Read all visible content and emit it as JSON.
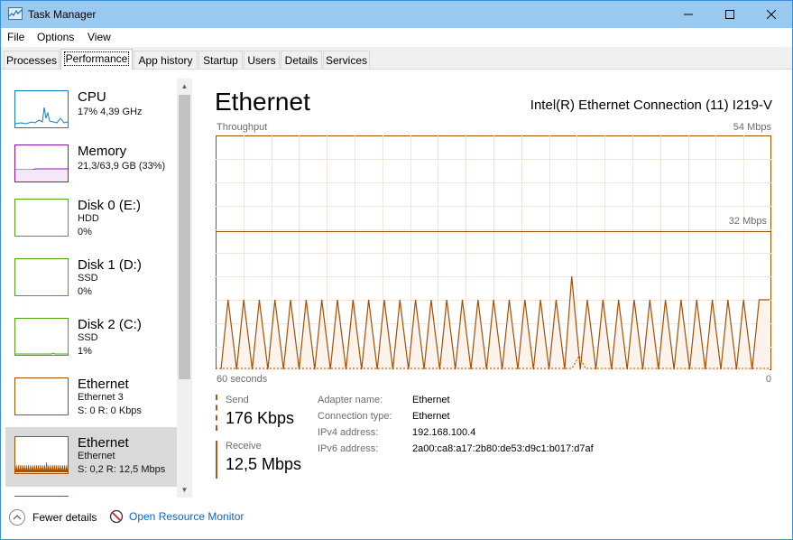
{
  "window": {
    "title": "Task Manager"
  },
  "menu": [
    {
      "label": "File"
    },
    {
      "label": "Options"
    },
    {
      "label": "View"
    }
  ],
  "tabs": [
    {
      "label": "Processes"
    },
    {
      "label": "Performance",
      "active": true
    },
    {
      "label": "App history"
    },
    {
      "label": "Startup"
    },
    {
      "label": "Users"
    },
    {
      "label": "Details"
    },
    {
      "label": "Services"
    }
  ],
  "sidebar": {
    "items": [
      {
        "title": "CPU",
        "line1": "17% 4,39 GHz",
        "line2": "",
        "color": "#117dbb"
      },
      {
        "title": "Memory",
        "line1": "21,3/63,9 GB (33%)",
        "line2": "",
        "color": "#8b12ae"
      },
      {
        "title": "Disk 0 (E:)",
        "line1": "HDD",
        "line2": "0%",
        "color": "#4da60c"
      },
      {
        "title": "Disk 1 (D:)",
        "line1": "SSD",
        "line2": "0%",
        "color": "#4da60c"
      },
      {
        "title": "Disk 2 (C:)",
        "line1": "SSD",
        "line2": "1%",
        "color": "#4da60c"
      },
      {
        "title": "Ethernet",
        "line1": "Ethernet 3",
        "line2": "S: 0 R: 0 Kbps",
        "color": "#a74f01"
      },
      {
        "title": "Ethernet",
        "line1": "Ethernet",
        "line2": "S: 0,2 R: 12,5 Mbps",
        "color": "#a74f01",
        "selected": true
      }
    ]
  },
  "main": {
    "title": "Ethernet",
    "adapter": "Intel(R) Ethernet Connection (11) I219-V",
    "graph": {
      "label": "Throughput",
      "max_label": "54 Mbps",
      "mid_label": "32 Mbps",
      "time_label": "60 seconds",
      "zero_label": "0",
      "line_color": "#a74f01",
      "peaks_fraction": [
        0.3,
        0.3,
        0.3,
        0.3,
        0.3,
        0.3,
        0.3,
        0.3,
        0.3,
        0.3,
        0.3,
        0.3,
        0.3,
        0.3,
        0.3,
        0.3,
        0.3,
        0.3,
        0.3,
        0.3,
        0.3,
        0.3,
        0.4,
        0.3,
        0.3,
        0.3,
        0.3,
        0.3,
        0.3,
        0.3,
        0.3,
        0.3,
        0.3,
        0.3,
        0.3
      ]
    },
    "send": {
      "label": "Send",
      "value": "176 Kbps"
    },
    "receive": {
      "label": "Receive",
      "value": "12,5 Mbps"
    },
    "details": [
      {
        "key": "Adapter name:",
        "value": "Ethernet"
      },
      {
        "key": "Connection type:",
        "value": "Ethernet"
      },
      {
        "key": "IPv4 address:",
        "value": "192.168.100.4"
      },
      {
        "key": "IPv6 address:",
        "value": "2a00:ca8:a17:2b80:de53:d9c1:b017:d7af"
      }
    ]
  },
  "footer": {
    "fewer_details": "Fewer details",
    "open_resmon": "Open Resource Monitor"
  }
}
